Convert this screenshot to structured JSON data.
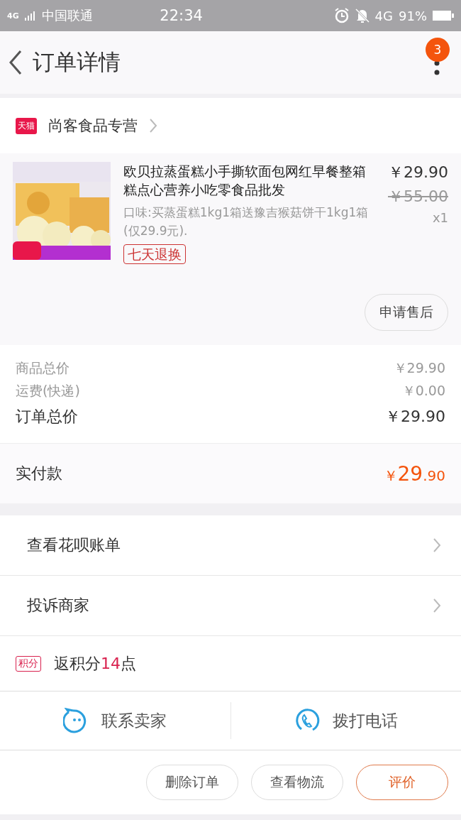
{
  "status_bar": {
    "network": "4G",
    "carrier": "中国联通",
    "time": "22:34",
    "data": "4G",
    "battery": "91%"
  },
  "header": {
    "title": "订单详情",
    "badge": "3"
  },
  "shop": {
    "badge": "天猫",
    "name": "尚客食品专营"
  },
  "product": {
    "kind": "picture",
    "title": "欧贝拉蒸蛋糕小手撕软面包网红早餐整箱糕点心营养小吃零食品批发",
    "price": "￥29.90",
    "original_price": "￥55.00",
    "quantity": "x1",
    "option": "口味:买蒸蛋糕1kg1箱送豫吉猴菇饼干1kg1箱(仅29.9元).",
    "tag": "七天退换",
    "after_sale": "申请售后"
  },
  "summary": [
    {
      "label": "商品总价",
      "value": "￥29.90",
      "kind": "minor"
    },
    {
      "label": "运费(快递)",
      "value": "￥0.00",
      "kind": "minor"
    },
    {
      "label": "订单总价",
      "value": "￥29.90",
      "kind": "major"
    }
  ],
  "paid": {
    "label": "实付款",
    "currency": "￥",
    "integer": "29",
    "decimal": ".90"
  },
  "links": [
    {
      "label": "查看花呗账单"
    },
    {
      "label": "投诉商家"
    }
  ],
  "points": {
    "badge": "积分",
    "prefix": "返积分",
    "amount": "14",
    "suffix": "点"
  },
  "contact": [
    {
      "label": "联系卖家",
      "kind": "chat"
    },
    {
      "label": "拨打电话",
      "kind": "phone"
    }
  ],
  "actions": [
    {
      "label": "删除订单",
      "kind": "normal"
    },
    {
      "label": "查看物流",
      "kind": "normal"
    },
    {
      "label": "评价",
      "kind": "primary"
    }
  ]
}
